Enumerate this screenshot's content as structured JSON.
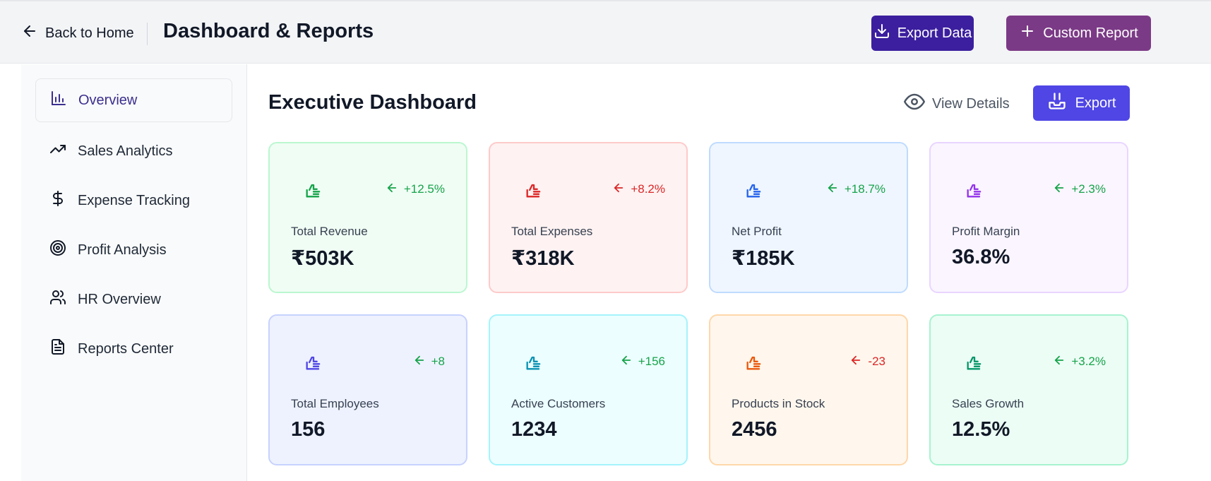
{
  "header": {
    "back_label": "Back to Home",
    "title": "Dashboard & Reports",
    "export_data_label": "Export Data",
    "custom_report_label": "Custom Report"
  },
  "sidebar": {
    "items": [
      {
        "label": "Overview",
        "icon": "bar-chart-icon",
        "active": true
      },
      {
        "label": "Sales Analytics",
        "icon": "trending-up-icon"
      },
      {
        "label": "Expense Tracking",
        "icon": "dollar-icon"
      },
      {
        "label": "Profit Analysis",
        "icon": "target-icon"
      },
      {
        "label": "HR Overview",
        "icon": "users-icon"
      },
      {
        "label": "Reports Center",
        "icon": "file-text-icon"
      }
    ]
  },
  "main": {
    "title": "Executive Dashboard",
    "view_details_label": "View Details",
    "export_label": "Export"
  },
  "cards": [
    {
      "label": "Total Revenue",
      "value": "₹503K",
      "change": "+12.5%",
      "change_color": "#16a34a",
      "icon_color": "#16a34a",
      "bg": "#f0fdf4",
      "border": "#bbf7d0"
    },
    {
      "label": "Total Expenses",
      "value": "₹318K",
      "change": "+8.2%",
      "change_color": "#dc2626",
      "icon_color": "#dc2626",
      "bg": "#fef2f2",
      "border": "#fecaca"
    },
    {
      "label": "Net Profit",
      "value": "₹185K",
      "change": "+18.7%",
      "change_color": "#16a34a",
      "icon_color": "#2563eb",
      "bg": "#eff6ff",
      "border": "#bfdbfe"
    },
    {
      "label": "Profit Margin",
      "value": "36.8%",
      "change": "+2.3%",
      "change_color": "#16a34a",
      "icon_color": "#9333ea",
      "bg": "#faf5ff",
      "border": "#e9d5ff"
    },
    {
      "label": "Total Employees",
      "value": "156",
      "change": "+8",
      "change_color": "#16a34a",
      "icon_color": "#4f46e5",
      "bg": "#eef2ff",
      "border": "#c7d2fe"
    },
    {
      "label": "Active Customers",
      "value": "1234",
      "change": "+156",
      "change_color": "#16a34a",
      "icon_color": "#0891b2",
      "bg": "#ecfeff",
      "border": "#a5f3fc"
    },
    {
      "label": "Products in Stock",
      "value": "2456",
      "change": "-23",
      "change_color": "#dc2626",
      "icon_color": "#ea580c",
      "bg": "#fff7ed",
      "border": "#fed7aa"
    },
    {
      "label": "Sales Growth",
      "value": "12.5%",
      "change": "+3.2%",
      "change_color": "#16a34a",
      "icon_color": "#059669",
      "bg": "#ecfdf5",
      "border": "#a7f3d0"
    }
  ]
}
